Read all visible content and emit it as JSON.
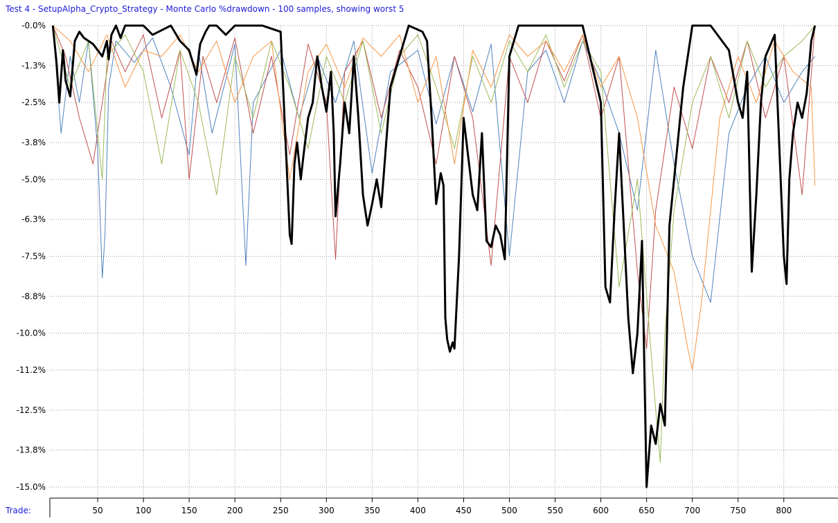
{
  "title": "Test 4 - SetupAlpha_Crypto_Strategy - Monte Carlo %drawdown - 100 samples, showing worst 5",
  "x_axis_label": "Trade:",
  "colors": {
    "title": "#1a1ad8",
    "main_series": "#000000",
    "sample_series": [
      "#4f81bd",
      "#c0504d",
      "#9bbb59",
      "#f79646",
      "#8064a2"
    ]
  },
  "chart_data": {
    "type": "line",
    "xlabel": "Trade:",
    "ylabel": "",
    "xlim": [
      0,
      835
    ],
    "ylim": [
      -15.0,
      0.0
    ],
    "x_ticks": [
      50,
      100,
      150,
      200,
      250,
      300,
      350,
      400,
      450,
      500,
      550,
      600,
      650,
      700,
      750,
      800
    ],
    "y_ticks": [
      -0.0,
      -1.3,
      -2.5,
      -3.8,
      -5.0,
      -6.3,
      -7.5,
      -8.8,
      -10.0,
      -11.2,
      -12.5,
      -13.8,
      -15.0
    ],
    "y_tick_labels": [
      "-0.0%",
      "-1.3%",
      "-2.5%",
      "-3.8%",
      "-5.0%",
      "-6.3%",
      "-7.5%",
      "-8.8%",
      "-10.0%",
      "-11.2%",
      "-12.5%",
      "-13.8%",
      "-15.0%"
    ],
    "grid": true,
    "series": [
      {
        "color": "#000000",
        "x": [
          1,
          5,
          8,
          12,
          15,
          20,
          25,
          30,
          35,
          45,
          55,
          60,
          62,
          65,
          70,
          75,
          80,
          100,
          110,
          130,
          140,
          150,
          158,
          162,
          168,
          172,
          180,
          190,
          200,
          230,
          250,
          260,
          262,
          265,
          268,
          272,
          275,
          280,
          285,
          290,
          295,
          300,
          305,
          308,
          310,
          315,
          320,
          325,
          330,
          335,
          340,
          345,
          350,
          355,
          360,
          370,
          390,
          405,
          410,
          415,
          420,
          425,
          428,
          430,
          432,
          435,
          438,
          440,
          445,
          450,
          460,
          465,
          470,
          475,
          480,
          485,
          490,
          495,
          500,
          510,
          540,
          580,
          600,
          605,
          610,
          615,
          620,
          625,
          630,
          635,
          640,
          645,
          650,
          655,
          660,
          665,
          670,
          675,
          680,
          690,
          700,
          720,
          740,
          750,
          755,
          760,
          765,
          770,
          775,
          780,
          790,
          800,
          803,
          806,
          810,
          815,
          820,
          825,
          830,
          834
        ],
        "y": [
          0,
          -1.2,
          -2.5,
          -0.8,
          -1.8,
          -2.3,
          -0.5,
          -0.2,
          -0.4,
          -0.6,
          -1.0,
          -0.5,
          -1.1,
          -0.3,
          0,
          -0.4,
          0,
          0,
          -0.3,
          0,
          -0.5,
          -0.8,
          -1.6,
          -0.6,
          -0.2,
          0,
          0,
          -0.3,
          0,
          0,
          -0.2,
          -6.8,
          -7.1,
          -4.5,
          -3.8,
          -5.0,
          -4.2,
          -3.0,
          -2.5,
          -1.0,
          -2.0,
          -2.8,
          -1.5,
          -3.5,
          -6.2,
          -4.5,
          -2.5,
          -3.5,
          -1.0,
          -3.0,
          -5.5,
          -6.5,
          -5.8,
          -5.0,
          -5.9,
          -2.0,
          0,
          -0.2,
          -0.5,
          -3.0,
          -5.8,
          -4.8,
          -5.2,
          -9.5,
          -10.2,
          -10.6,
          -10.3,
          -10.5,
          -7.5,
          -3.0,
          -5.5,
          -6.0,
          -3.5,
          -7.0,
          -7.2,
          -6.5,
          -6.8,
          -7.6,
          -1.0,
          0,
          0,
          0,
          -2.5,
          -8.5,
          -9.0,
          -6.0,
          -3.5,
          -6.5,
          -9.5,
          -11.3,
          -10.0,
          -7.0,
          -15.0,
          -13.0,
          -13.6,
          -12.3,
          -13.0,
          -6.5,
          -5.0,
          -2.0,
          0,
          0,
          -0.8,
          -2.5,
          -3.0,
          -1.5,
          -8.0,
          -5.5,
          -2.5,
          -1.0,
          -0.3,
          -7.5,
          -8.4,
          -5.0,
          -3.5,
          -2.5,
          -3.0,
          -2.2,
          -0.5,
          0
        ]
      },
      {
        "color": "#4f81bd",
        "x": [
          1,
          10,
          20,
          30,
          40,
          50,
          55,
          58,
          62,
          70,
          90,
          110,
          130,
          150,
          160,
          175,
          200,
          212,
          220,
          250,
          270,
          290,
          310,
          330,
          350,
          370,
          400,
          420,
          440,
          460,
          480,
          500,
          520,
          540,
          560,
          580,
          600,
          620,
          640,
          660,
          680,
          700,
          720,
          740,
          760,
          780,
          800,
          820,
          834
        ],
        "y": [
          0,
          -3.5,
          -1.0,
          -2.5,
          -0.5,
          -4.0,
          -8.2,
          -6.8,
          -2.0,
          -0.5,
          -1.2,
          -0.4,
          -2.0,
          -4.2,
          -0.8,
          -3.5,
          -0.6,
          -7.8,
          -2.5,
          -0.8,
          -3.0,
          -1.0,
          -2.5,
          -0.5,
          -4.8,
          -1.5,
          -0.8,
          -3.2,
          -1.0,
          -2.8,
          -0.6,
          -7.5,
          -1.5,
          -0.8,
          -2.5,
          -0.5,
          -1.8,
          -3.5,
          -6.0,
          -0.8,
          -4.5,
          -7.5,
          -9.0,
          -3.5,
          -2.0,
          -1.0,
          -2.5,
          -1.5,
          -1.0
        ]
      },
      {
        "color": "#c0504d",
        "x": [
          1,
          15,
          30,
          45,
          55,
          65,
          80,
          100,
          120,
          140,
          150,
          165,
          180,
          200,
          220,
          240,
          260,
          280,
          300,
          310,
          320,
          340,
          360,
          380,
          400,
          420,
          440,
          460,
          480,
          500,
          520,
          540,
          560,
          580,
          600,
          620,
          640,
          650,
          660,
          680,
          700,
          720,
          740,
          760,
          780,
          800,
          820,
          834
        ],
        "y": [
          0,
          -1.0,
          -3.0,
          -4.5,
          -2.5,
          -0.5,
          -1.5,
          -0.3,
          -3.0,
          -0.8,
          -5.0,
          -1.0,
          -2.5,
          -0.4,
          -3.5,
          -1.0,
          -4.2,
          -0.6,
          -2.5,
          -7.6,
          -1.5,
          -0.5,
          -3.0,
          -0.8,
          -2.0,
          -4.5,
          -1.0,
          -3.0,
          -7.8,
          -1.0,
          -2.5,
          -0.5,
          -1.8,
          -0.3,
          -3.0,
          -1.0,
          -8.0,
          -10.5,
          -6.0,
          -2.0,
          -4.0,
          -1.0,
          -2.5,
          -0.5,
          -3.0,
          -1.0,
          -5.5,
          0
        ]
      },
      {
        "color": "#9bbb59",
        "x": [
          1,
          20,
          40,
          55,
          60,
          80,
          100,
          120,
          140,
          160,
          180,
          200,
          220,
          240,
          260,
          280,
          300,
          320,
          340,
          360,
          380,
          400,
          420,
          440,
          460,
          480,
          500,
          520,
          540,
          560,
          580,
          600,
          620,
          640,
          660,
          665,
          670,
          680,
          700,
          720,
          740,
          760,
          780,
          800,
          820,
          834
        ],
        "y": [
          0,
          -2.0,
          -0.5,
          -5.0,
          -1.0,
          -0.3,
          -1.5,
          -4.5,
          -0.8,
          -2.5,
          -5.5,
          -1.0,
          -3.0,
          -0.5,
          -2.0,
          -4.0,
          -1.0,
          -2.5,
          -0.5,
          -3.5,
          -1.0,
          -0.3,
          -2.0,
          -4.0,
          -1.0,
          -2.5,
          -0.5,
          -1.5,
          -0.3,
          -2.0,
          -0.5,
          -1.5,
          -8.5,
          -5.0,
          -12.5,
          -14.2,
          -10.0,
          -6.0,
          -2.5,
          -1.0,
          -3.0,
          -0.5,
          -2.0,
          -1.0,
          -0.5,
          0
        ]
      },
      {
        "color": "#f79646",
        "x": [
          1,
          20,
          40,
          60,
          80,
          100,
          120,
          140,
          160,
          180,
          200,
          220,
          240,
          260,
          280,
          300,
          320,
          340,
          360,
          380,
          400,
          420,
          440,
          460,
          480,
          500,
          520,
          540,
          560,
          580,
          600,
          620,
          640,
          660,
          680,
          695,
          700,
          710,
          730,
          750,
          770,
          790,
          810,
          830,
          834
        ],
        "y": [
          0,
          -0.5,
          -1.5,
          -0.3,
          -2.0,
          -0.8,
          -1.0,
          -0.3,
          -1.5,
          -0.5,
          -2.5,
          -1.0,
          -0.5,
          -5.0,
          -1.5,
          -0.6,
          -2.0,
          -0.4,
          -1.0,
          -0.3,
          -2.5,
          -1.0,
          -4.5,
          -0.8,
          -2.0,
          -0.3,
          -1.0,
          -0.5,
          -1.5,
          -0.3,
          -2.0,
          -1.0,
          -3.0,
          -6.5,
          -8.0,
          -10.5,
          -11.2,
          -9.0,
          -3.0,
          -1.0,
          -2.5,
          -0.5,
          -1.5,
          -2.0,
          -5.2
        ]
      }
    ]
  }
}
